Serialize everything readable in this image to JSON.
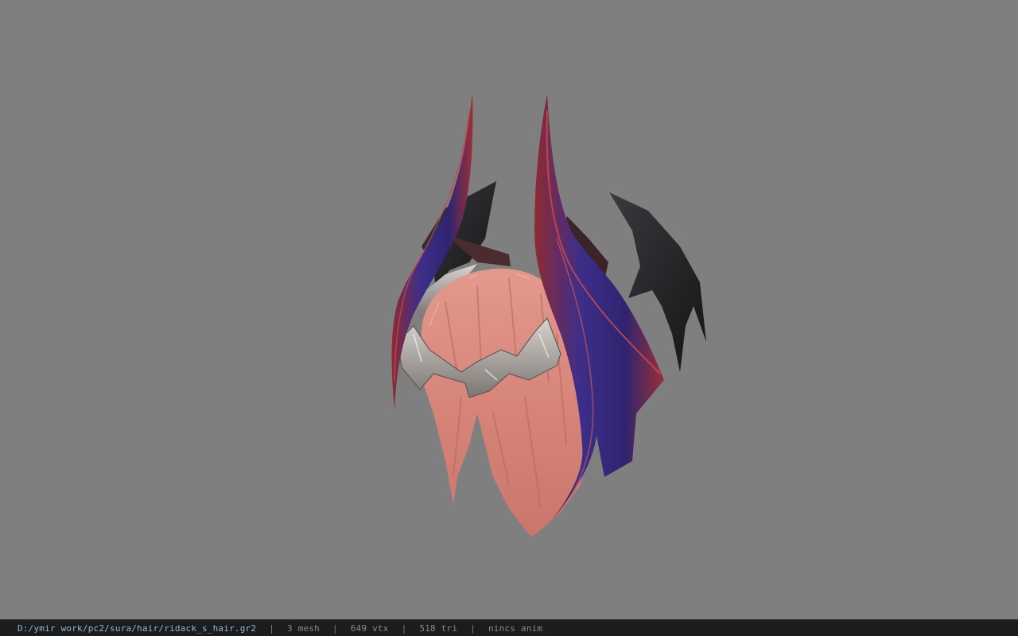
{
  "statusbar": {
    "file_path": "D:/ymir work/pc2/sura/hair/ridack_s_hair.gr2",
    "separator": "|",
    "mesh_count": "3 mesh",
    "vertex_count": "649 vtx",
    "triangle_count": "518 tri",
    "anim_status": "nincs anim"
  },
  "viewport": {
    "background_color": "#7f7f7f",
    "model": "hair-model"
  }
}
